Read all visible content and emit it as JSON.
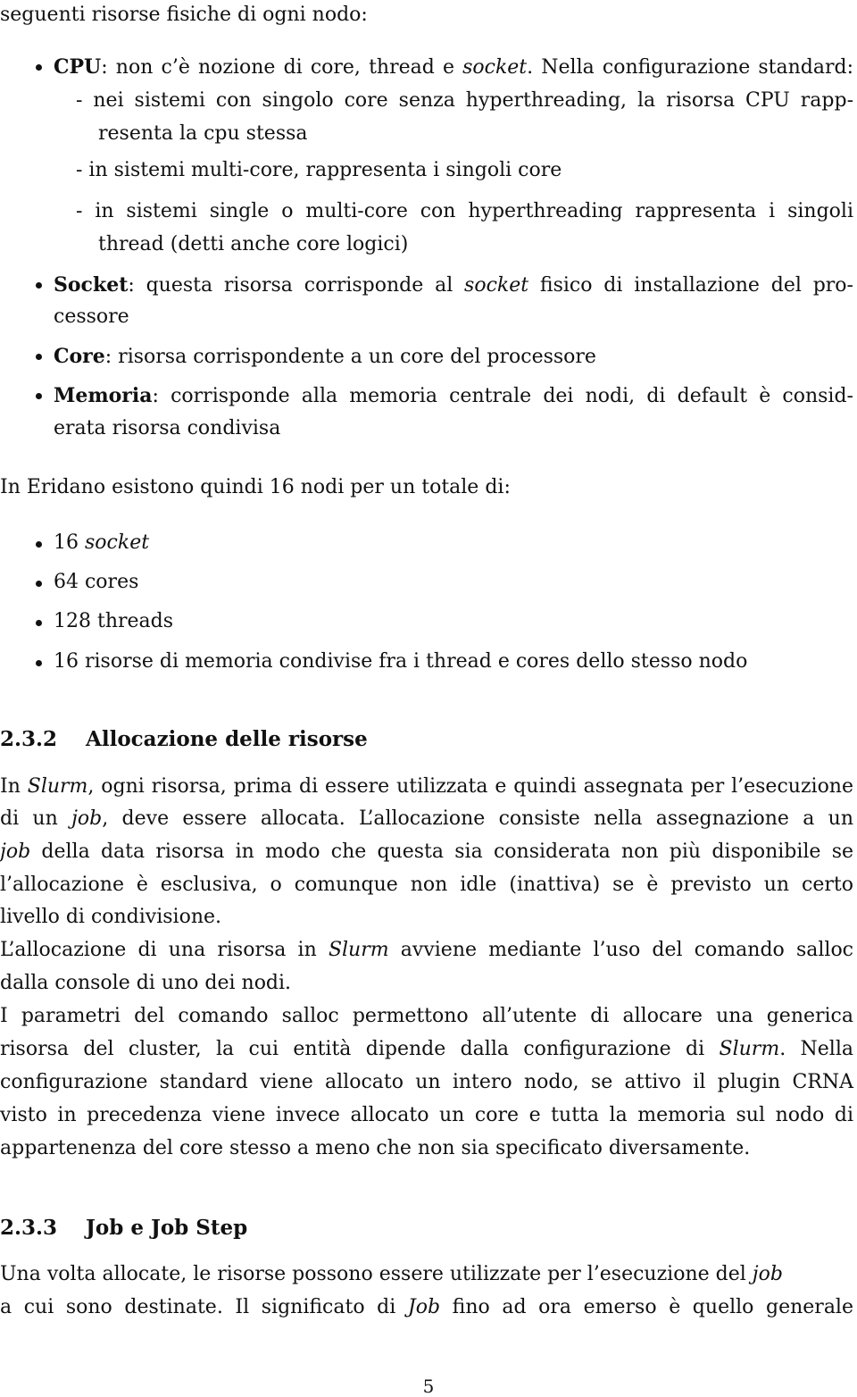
{
  "intro": "seguenti risorse fisiche di ogni nodo:",
  "resources": {
    "cpu": {
      "term": "CPU",
      "text_pre": ": non c’è nozione di core, thread e ",
      "text_em": "socket",
      "text_post": ".  Nella configurazione standard:",
      "sub": [
        [
          "- nei sistemi con singolo core senza hyperthreading, la risorsa CPU rapp-",
          "resenta la cpu stessa"
        ],
        [
          "- in sistemi multi-core, rappresenta i singoli core"
        ],
        [
          "- in sistemi single o multi-core con hyperthreading rappresenta i singoli",
          "thread (detti anche core logici)"
        ]
      ]
    },
    "socket": {
      "term": "Socket",
      "text_pre": ":  questa risorsa corrisponde al ",
      "text_em": "socket",
      "text_post": " fisico di installazione del pro-",
      "cont": "cessore"
    },
    "core": {
      "term": "Core",
      "text": ": risorsa corrispondente a un core del processore"
    },
    "memoria": {
      "term": "Memoria",
      "text": ": corrisponde alla memoria centrale dei nodi, di default è consid-",
      "cont": "erata risorsa condivisa"
    }
  },
  "eridano": {
    "text": "In Eridano esistono quindi 16 nodi per un totale di:",
    "items": [
      {
        "pre": "16 ",
        "em": "socket"
      },
      {
        "pre": "64 cores",
        "em": ""
      },
      {
        "pre": "128 threads",
        "em": ""
      },
      {
        "pre": "16 risorse di memoria condivise fra i thread e cores dello stesso nodo",
        "em": ""
      }
    ]
  },
  "section_232": {
    "number": "2.3.2",
    "title": "Allocazione delle risorse",
    "lines": [
      [
        "In ",
        "Slurm",
        ", ogni risorsa, prima di essere utilizzata e quindi assegnata per l’esecuzione"
      ],
      [
        "di un ",
        "job",
        ", deve essere allocata.  L’allocazione consiste nella assegnazione a un"
      ],
      [
        "",
        "job",
        " della data risorsa in modo che questa sia considerata non più disponibile se"
      ],
      [
        "l’allocazione è esclusiva, o comunque non idle (inattiva) se è previsto un certo",
        "",
        ""
      ],
      [
        "livello di condivisione.",
        "",
        ""
      ],
      [
        "L’allocazione di una risorsa in ",
        "Slurm",
        " avviene mediante l’uso del comando salloc"
      ],
      [
        "dalla console di uno dei nodi.",
        "",
        ""
      ],
      [
        "I parametri del comando salloc permettono all’utente di allocare una generica",
        "",
        ""
      ],
      [
        "risorsa del cluster, la cui entità dipende dalla configurazione di ",
        "Slurm",
        ".  Nella"
      ],
      [
        "configurazione standard viene allocato un intero nodo, se attivo il plugin CRNA",
        "",
        ""
      ],
      [
        "visto in precedenza viene invece allocato un core e tutta la memoria sul nodo di",
        "",
        ""
      ],
      [
        "appartenenza del core stesso a meno che non sia specificato diversamente.",
        "",
        ""
      ]
    ]
  },
  "section_233": {
    "number": "2.3.3",
    "title": "Job e Job Step",
    "lines": [
      [
        "Una volta allocate, le risorse possono essere utilizzate per l’esecuzione del ",
        "job",
        ""
      ],
      [
        "a cui sono destinate.  Il significato di ",
        "Job",
        " fino ad ora emerso è quello generale"
      ]
    ]
  },
  "page_number": "5"
}
